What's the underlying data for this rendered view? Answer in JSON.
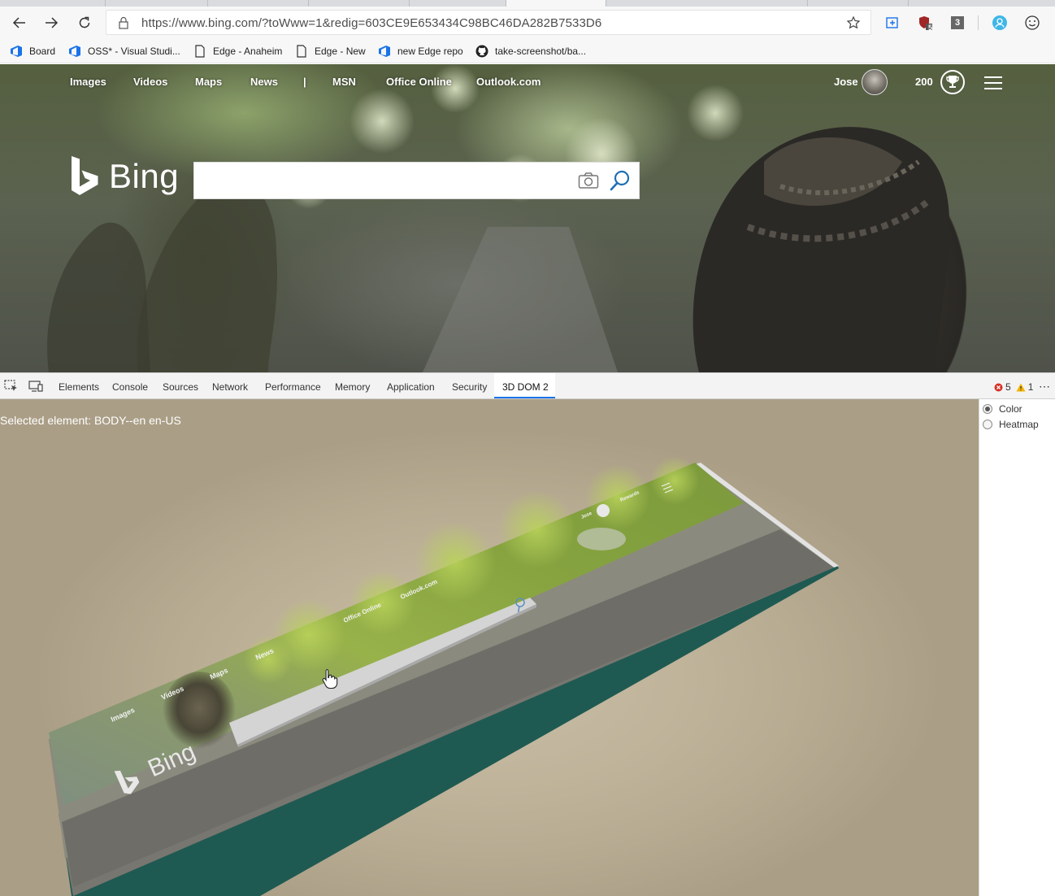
{
  "browser": {
    "url": "https://www.bing.com/?toWww=1&redig=603CE9E653434C98BC46DA282B7533D6",
    "extension_badges": {
      "shield": "5",
      "counter": "3"
    },
    "bookmarks": [
      {
        "label": "Board",
        "icon": "azure-devops-icon"
      },
      {
        "label": "OSS* - Visual Studi...",
        "icon": "azure-devops-icon"
      },
      {
        "label": "Edge - Anaheim",
        "icon": "page-icon"
      },
      {
        "label": "Edge - New",
        "icon": "page-icon"
      },
      {
        "label": "new Edge repo",
        "icon": "azure-devops-icon"
      },
      {
        "label": "take-screenshot/ba...",
        "icon": "github-icon"
      }
    ]
  },
  "bing": {
    "nav": [
      "Images",
      "Videos",
      "Maps",
      "News",
      "|",
      "MSN",
      "Office Online",
      "Outlook.com"
    ],
    "user_name": "Jose",
    "points": "200",
    "logo_text": "Bing"
  },
  "devtools": {
    "tabs": [
      "Elements",
      "Console",
      "Sources",
      "Network",
      "Performance",
      "Memory",
      "Application",
      "Security",
      "3D DOM 2"
    ],
    "active_tab": "3D DOM 2",
    "errors": "5",
    "warnings": "1",
    "more": "⋯",
    "selected_element": "Selected element: BODY--en en-US",
    "view_modes": [
      {
        "label": "Color",
        "checked": true
      },
      {
        "label": "Heatmap",
        "checked": false
      }
    ],
    "scene_labels": {
      "images": "Images",
      "videos": "Videos",
      "maps": "Maps",
      "news": "News",
      "office": "Office Online",
      "outlook": "Outlook.com",
      "user": "Jose",
      "rewards": "Rewards",
      "bing": "Bing"
    }
  },
  "colors": {
    "accent_blue": "#1a73e8",
    "error_red": "#d93025",
    "warning_yellow": "#f4b400",
    "slab_side": "#1f5a52"
  }
}
